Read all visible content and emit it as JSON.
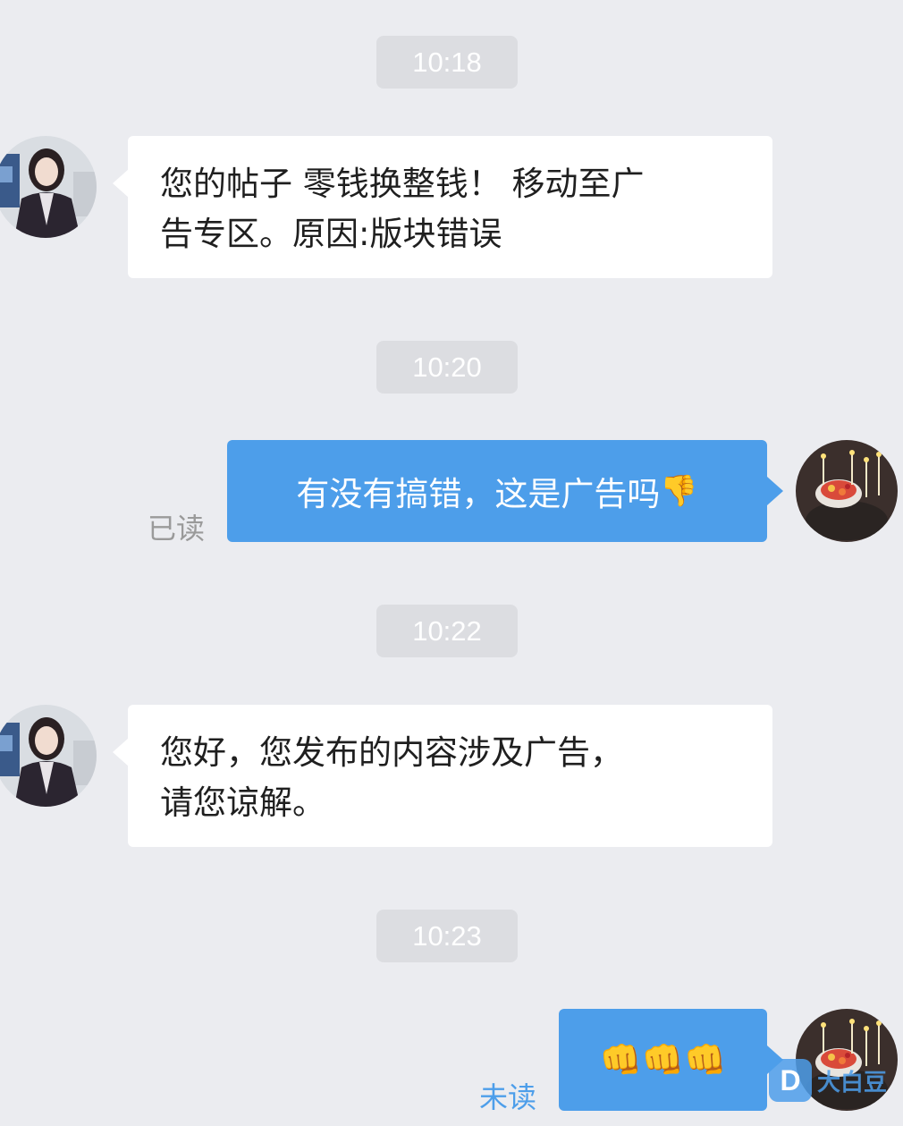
{
  "messages": [
    {
      "time": "10:18",
      "direction": "in",
      "lines": [
        "您的帖子 零钱换整钱！ 移动至广",
        "告专区。原因:版块错误"
      ]
    },
    {
      "time": "10:20",
      "direction": "out",
      "text": "有没有搞错，这是广告吗",
      "emoji": "👎",
      "status": "已读"
    },
    {
      "time": "10:22",
      "direction": "in",
      "lines": [
        "您好，您发布的内容涉及广告，",
        "请您谅解。"
      ]
    },
    {
      "time": "10:23",
      "direction": "out",
      "text": "",
      "emoji": "👊👊👊",
      "status": "未读"
    }
  ],
  "status_colors": {
    "read": "#9a9a9a",
    "unread": "#4d9eea"
  },
  "watermark": {
    "letter": "D",
    "text": "大白豆"
  },
  "colors": {
    "background": "#ebecf0",
    "incoming_bubble": "#ffffff",
    "outgoing_bubble": "#4d9eea",
    "time_pill": "#dcdde1"
  }
}
